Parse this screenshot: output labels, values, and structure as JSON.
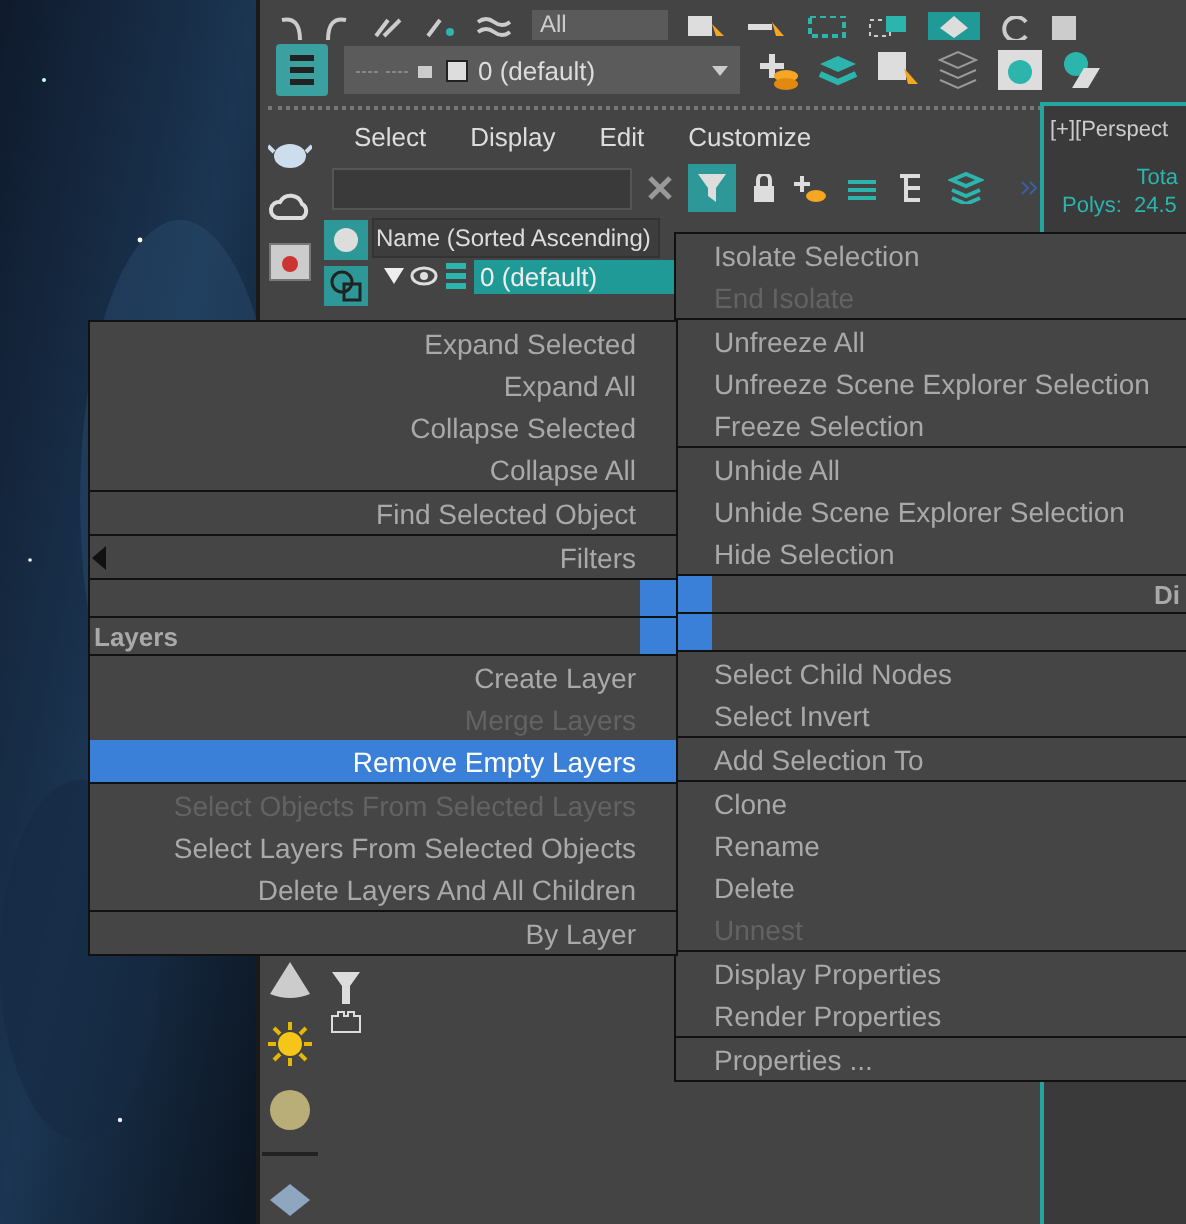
{
  "toolbar": {
    "filter_dropdown": "All",
    "layer_dropdown": "0 (default)"
  },
  "explorer": {
    "menu": [
      "Select",
      "Display",
      "Edit",
      "Customize"
    ],
    "column_header": "Name (Sorted Ascending)",
    "tree": [
      {
        "label": "0 (default)",
        "selected": true,
        "expanded": true
      }
    ]
  },
  "viewport": {
    "label": "[+][Perspect",
    "stats_heading": "Tota",
    "stats": [
      {
        "label": "Polys:",
        "value": "24.5"
      }
    ]
  },
  "left_menu": {
    "sections": [
      [
        {
          "kind": "item",
          "label": "Expand Selected",
          "disabled": false,
          "selected": false
        },
        {
          "kind": "item",
          "label": "Expand All",
          "disabled": false,
          "selected": false
        },
        {
          "kind": "item",
          "label": "Collapse Selected",
          "disabled": false,
          "selected": false
        },
        {
          "kind": "item",
          "label": "Collapse All",
          "disabled": false,
          "selected": false
        }
      ],
      [
        {
          "kind": "item",
          "label": "Find Selected Object",
          "disabled": false,
          "selected": false
        }
      ],
      [
        {
          "kind": "submenu",
          "label": "Filters",
          "disabled": false,
          "selected": false
        }
      ],
      [
        {
          "kind": "header"
        }
      ],
      [
        {
          "kind": "header",
          "label": "Layers"
        }
      ],
      [
        {
          "kind": "item",
          "label": "Create Layer",
          "disabled": false,
          "selected": false
        },
        {
          "kind": "item",
          "label": "Merge Layers",
          "disabled": true,
          "selected": false
        },
        {
          "kind": "item",
          "label": "Remove Empty Layers",
          "disabled": false,
          "selected": true
        }
      ],
      [
        {
          "kind": "item",
          "label": "Select Objects From Selected Layers",
          "disabled": true,
          "selected": false
        },
        {
          "kind": "item",
          "label": "Select Layers From Selected Objects",
          "disabled": false,
          "selected": false
        },
        {
          "kind": "item",
          "label": "Delete Layers And All Children",
          "disabled": false,
          "selected": false
        }
      ],
      [
        {
          "kind": "item",
          "label": "By Layer",
          "disabled": false,
          "selected": false
        }
      ]
    ]
  },
  "right_menu": {
    "sections": [
      [
        {
          "kind": "item",
          "label": "Isolate Selection",
          "disabled": false,
          "selected": false
        },
        {
          "kind": "item",
          "label": "End Isolate",
          "disabled": true,
          "selected": false
        }
      ],
      [
        {
          "kind": "item",
          "label": "Unfreeze All",
          "disabled": false,
          "selected": false
        },
        {
          "kind": "item",
          "label": "Unfreeze Scene Explorer Selection",
          "disabled": false,
          "selected": false
        },
        {
          "kind": "item",
          "label": "Freeze Selection",
          "disabled": false,
          "selected": false
        }
      ],
      [
        {
          "kind": "item",
          "label": "Unhide All",
          "disabled": false,
          "selected": false
        },
        {
          "kind": "item",
          "label": "Unhide Scene Explorer Selection",
          "disabled": false,
          "selected": false
        },
        {
          "kind": "item",
          "label": "Hide Selection",
          "disabled": false,
          "selected": false
        }
      ],
      [
        {
          "kind": "header",
          "label": "Di"
        }
      ],
      [
        {
          "kind": "header"
        }
      ],
      [
        {
          "kind": "item",
          "label": "Select Child Nodes",
          "disabled": false,
          "selected": false
        },
        {
          "kind": "item",
          "label": "Select Invert",
          "disabled": false,
          "selected": false
        }
      ],
      [
        {
          "kind": "item",
          "label": "Add Selection To",
          "disabled": false,
          "selected": false
        }
      ],
      [
        {
          "kind": "item",
          "label": "Clone",
          "disabled": false,
          "selected": false
        },
        {
          "kind": "item",
          "label": "Rename",
          "disabled": false,
          "selected": false
        },
        {
          "kind": "item",
          "label": "Delete",
          "disabled": false,
          "selected": false
        },
        {
          "kind": "item",
          "label": "Unnest",
          "disabled": true,
          "selected": false
        }
      ],
      [
        {
          "kind": "item",
          "label": "Display Properties",
          "disabled": false,
          "selected": false
        },
        {
          "kind": "item",
          "label": "Render Properties",
          "disabled": false,
          "selected": false
        }
      ],
      [
        {
          "kind": "item",
          "label": "Properties ...",
          "disabled": false,
          "selected": false
        }
      ]
    ]
  }
}
